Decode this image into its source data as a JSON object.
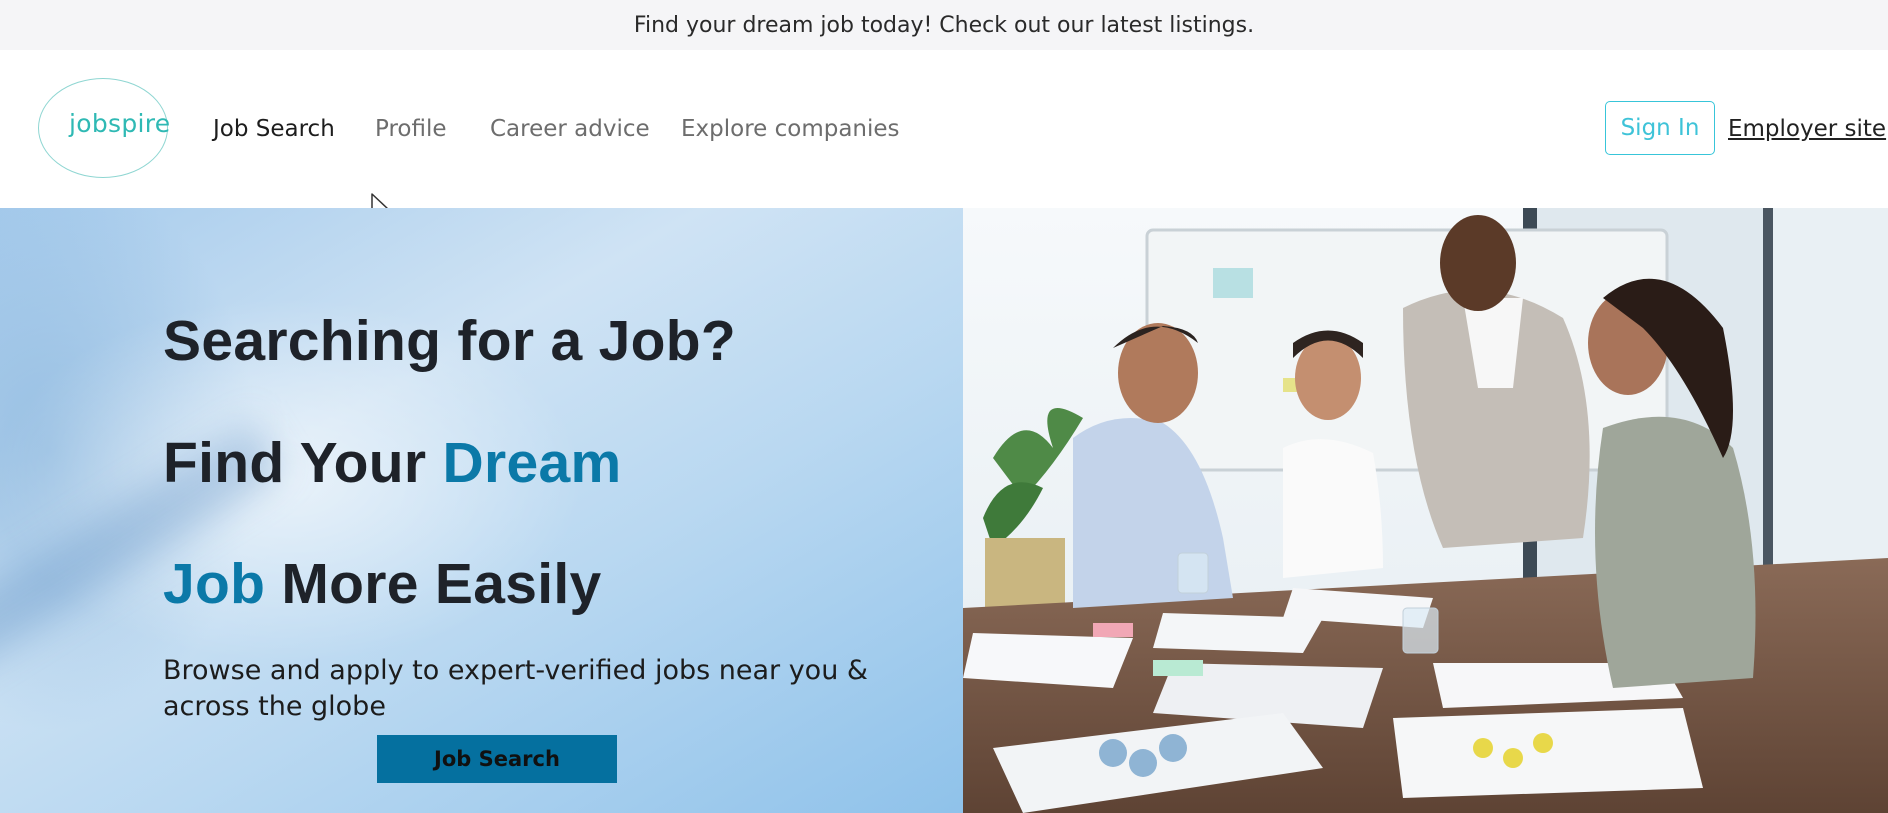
{
  "banner": {
    "text": "Find your dream job today! Check out our latest listings."
  },
  "header": {
    "logo_text": "jobspire",
    "nav": [
      {
        "label": "Job Search",
        "active": true
      },
      {
        "label": "Profile",
        "active": false
      },
      {
        "label": "Career advice",
        "active": false
      },
      {
        "label": "Explore companies",
        "active": false
      }
    ],
    "sign_in_label": "Sign In",
    "employer_label": "Employer site"
  },
  "hero": {
    "line1": "Searching for a Job?",
    "line2_a": "Find Your ",
    "line2_b": "Dream",
    "line3_a": "Job",
    "line3_b": " More Easily",
    "subtitle": "Browse and apply to expert-verified jobs near you & across the globe",
    "cta_label": "Job Search",
    "image_icon": "office-meeting-photo"
  },
  "colors": {
    "brand_teal": "#2fb9b4",
    "accent_blue": "#0b79a8",
    "cta_bg": "#05709f",
    "sign_in_border": "#38c5d9"
  }
}
